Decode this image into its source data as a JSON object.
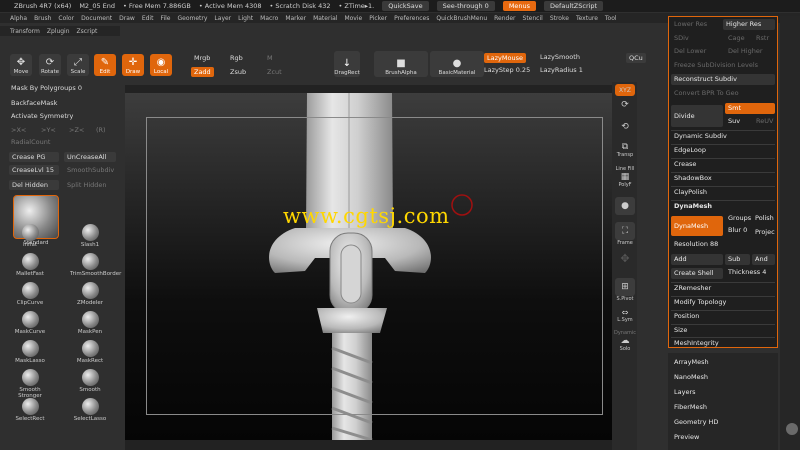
{
  "title_bar": {
    "app_title": "ZBrush 4R7 (x64)",
    "document": "M2_05 End",
    "free_mem": "• Free Mem 7.886GB",
    "active_mem": "• Active Mem 4308",
    "scratch_disk": "• Scratch Disk 432",
    "ztime": "• ZTime▸1.",
    "quicksave": "QuickSave",
    "see_through": "See-through  0",
    "menus": "Menus",
    "default_script": "DefaultZScript"
  },
  "menu_row1": [
    "Alpha",
    "Brush",
    "Color",
    "Document",
    "Draw",
    "Edit",
    "File",
    "Geometry",
    "Layer",
    "Light",
    "Macro",
    "Marker",
    "Material",
    "Movie",
    "Picker",
    "Preferences",
    "QuickBrushMenu",
    "Render",
    "Stencil",
    "Stroke",
    "Texture",
    "Tool"
  ],
  "menu_row2": [
    "Transform",
    "Zplugin",
    "Zscript"
  ],
  "toolbar": {
    "move": "Move",
    "rotate": "Rotate",
    "scale": "Scale",
    "edit": "Edit",
    "draw": "Draw",
    "local": "Local",
    "mrgb": "Mrgb",
    "rgb": "Rgb",
    "m": "M",
    "zadd": "Zadd",
    "zsub": "Zsub",
    "zcut": "Zcut",
    "drag_rect": "DragRect",
    "brush_alpha": "BrushAlpha",
    "basic_material": "BasicMaterial",
    "lazy_mouse": "LazyMouse",
    "lazy_smooth": "LazySmooth",
    "lazy_step": "LazyStep 0.25",
    "lazy_radius": "LazyRadius 1",
    "qcu": "QCu"
  },
  "left_panel": {
    "mask_by_polygroups": "Mask By Polygroups 0",
    "backface_mask": "BackfaceMask",
    "activate_symmetry": "Activate Symmetry",
    "x": ">X<",
    "y": ">Y<",
    "z": ">Z<",
    "r": "(R)",
    "radial_count": "RadialCount",
    "crease_pg": "Crease PG",
    "uncrease_all": "UnCreaseAll",
    "crease_lvl": "CreaseLvl 15",
    "smooth_subdiv": "SmoothSubdiv",
    "del_hidden": "Del Hidden",
    "split_hidden": "Split Hidden",
    "brushes": [
      "Standard",
      "Inflat",
      "Slash1",
      "MalletFast",
      "TrimSmoothBorder",
      "ClipCurve",
      "ZModeler",
      "MaskCurve",
      "MaskPen",
      "MaskLasso",
      "MaskRect",
      "Smooth Stronger",
      "Smooth",
      "SelectRect",
      "SelectLasso"
    ]
  },
  "right_dock": {
    "xyz": "XYZ",
    "transp": "Transp",
    "line_fill": "Line Fill",
    "polyf": "PolyF",
    "frame": "Frame",
    "spivot": "S.Pivot",
    "lsym": "L.Sym",
    "dynamic": "Dynamic",
    "solo": "Solo"
  },
  "right_panel": {
    "lower_res": "Lower Res",
    "higher_res": "Higher Res",
    "sdiv": "SDiv",
    "cage": "Cage",
    "rstr": "Rstr",
    "del_lower": "Del Lower",
    "del_higher": "Del Higher",
    "freeze": "Freeze SubDivision Levels",
    "reconstruct": "Reconstruct Subdiv",
    "convert_bpr": "Convert BPR To Geo",
    "divide": "Divide",
    "smt": "Smt",
    "suv": "Suv",
    "reuv": "ReUV",
    "dynamic_subdiv": "Dynamic Subdiv",
    "edgeloop": "EdgeLoop",
    "crease": "Crease",
    "shadowbox": "ShadowBox",
    "claypolish": "ClayPolish",
    "dynamesh_header": "DynaMesh",
    "dynamesh_btn": "DynaMesh",
    "groups": "Groups",
    "polish": "Polish",
    "blur": "Blur 0",
    "project": "Projec",
    "resolution": "Resolution 88",
    "add": "Add",
    "sub": "Sub",
    "and": "And",
    "create_shell": "Create Shell",
    "thickness": "Thickness 4",
    "zremesher": "ZRemesher",
    "modify_topology": "Modify Topology",
    "position": "Position",
    "size": "Size",
    "mesh_integrity": "MeshIntegrity"
  },
  "sub_panel": [
    "ArrayMesh",
    "NanoMesh",
    "Layers",
    "FiberMesh",
    "Geometry HD",
    "Preview"
  ],
  "watermark": "www.cgtsj.com",
  "colors": {
    "accent": "#e0660c",
    "panel": "#2f2f2f",
    "watermark": "#ffd700"
  }
}
